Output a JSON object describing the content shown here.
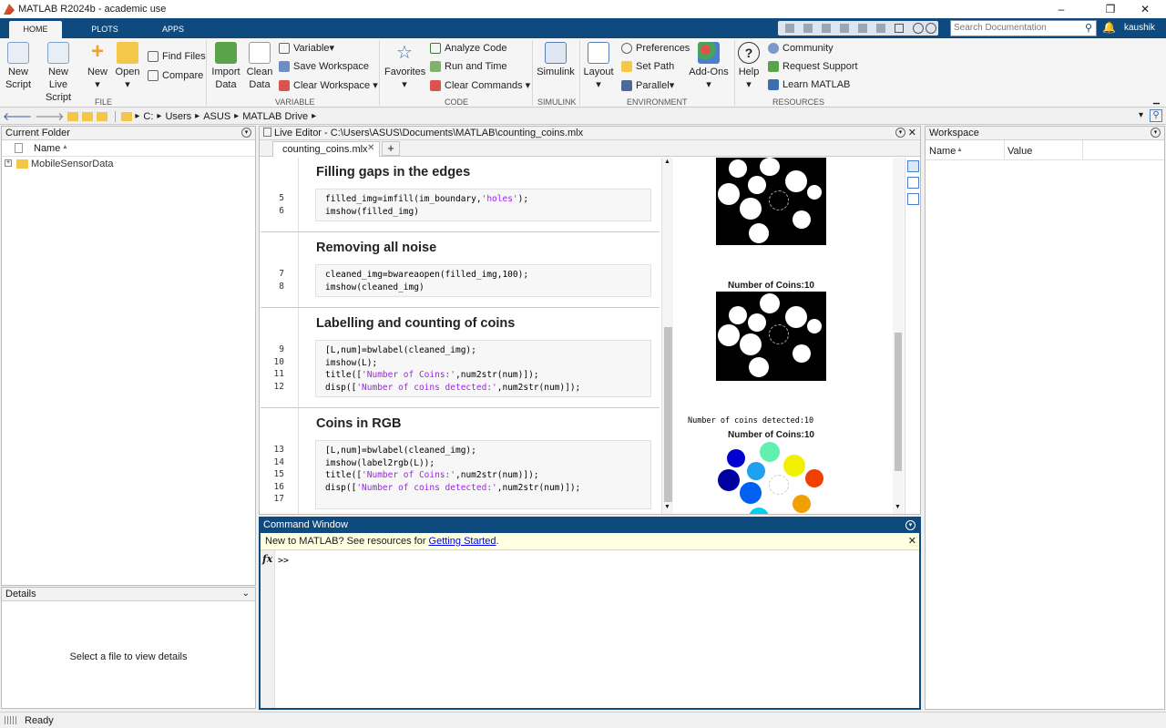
{
  "window": {
    "title": "MATLAB R2024b - academic use",
    "min": "–",
    "max": "❐",
    "close": "✕"
  },
  "ribbon_tabs": [
    "HOME",
    "PLOTS",
    "APPS"
  ],
  "search": {
    "placeholder": "Search Documentation"
  },
  "user": "kaushik",
  "ribbon": {
    "new_script": "New\nScript",
    "new_live_script": "New\nLive Script",
    "new": "New",
    "open": "Open",
    "find_files": "Find Files",
    "compare": "Compare",
    "import_data": "Import\nData",
    "clean_data": "Clean\nData",
    "variable": "Variable",
    "save_workspace": "Save Workspace",
    "clear_workspace": "Clear Workspace",
    "favorites": "Favorites",
    "analyze_code": "Analyze Code",
    "run_and_time": "Run and Time",
    "clear_commands": "Clear Commands",
    "simulink": "Simulink",
    "layout": "Layout",
    "preferences": "Preferences",
    "set_path": "Set Path",
    "parallel": "Parallel",
    "add_ons": "Add-Ons",
    "help": "Help",
    "community": "Community",
    "request_support": "Request Support",
    "learn_matlab": "Learn MATLAB",
    "groups": [
      "FILE",
      "VARIABLE",
      "CODE",
      "SIMULINK",
      "ENVIRONMENT",
      "RESOURCES"
    ]
  },
  "address": [
    "C:",
    "Users",
    "ASUS",
    "MATLAB Drive"
  ],
  "current_folder": {
    "title": "Current Folder",
    "column": "Name",
    "items": [
      "MobileSensorData"
    ]
  },
  "details": {
    "title": "Details",
    "empty": "Select a file to view details"
  },
  "editor": {
    "title": "Live Editor - C:\\Users\\ASUS\\Documents\\MATLAB\\counting_coins.mlx",
    "tab": "counting_coins.mlx",
    "sections": [
      {
        "heading": "Filling gaps in the edges",
        "lines": [
          "5",
          "6"
        ]
      },
      {
        "heading": "Removing all noise",
        "lines": [
          "7",
          "8"
        ]
      },
      {
        "heading": "Labelling and counting of coins",
        "lines": [
          "9",
          "10",
          "11",
          "12"
        ]
      },
      {
        "heading": "Coins in RGB",
        "lines": [
          "13",
          "14",
          "15",
          "16",
          "17"
        ]
      }
    ],
    "code": {
      "l5a": "filled_img=imfill(im_boundary,",
      "l5s": "'holes'",
      "l5b": ");",
      "l6": "imshow(filled_img)",
      "l7": "cleaned_img=bwareaopen(filled_img,100);",
      "l8": "imshow(cleaned_img)",
      "l9": "[L,num]=bwlabel(cleaned_img);",
      "l10": "imshow(L);",
      "l11a": "title([",
      "l11s": "'Number of Coins:'",
      "l11b": ",num2str(num)]);",
      "l12a": "disp([",
      "l12s": "'Number of coins detected:'",
      "l12b": ",num2str(num)]);",
      "l13": "[L,num]=bwlabel(cleaned_img);",
      "l14": "imshow(label2rgb(L));",
      "l15a": "title([",
      "l15s": "'Number of Coins:'",
      "l15b": ",num2str(num)]);",
      "l16a": "disp([",
      "l16s": "'Number of coins detected:'",
      "l16b": ",num2str(num)]);"
    },
    "output": {
      "fig_title": "Number of Coins:10",
      "fig_title2": "Number of Coins:10",
      "disp_text": "Number of coins detected:10"
    }
  },
  "command_window": {
    "title": "Command Window",
    "notice": "New to MATLAB? See resources for ",
    "link": "Getting Started",
    "period": ".",
    "fx": "fx",
    "prompt": ">>"
  },
  "workspace": {
    "title": "Workspace",
    "col_name": "Name",
    "col_value": "Value"
  },
  "status": {
    "text": "Ready"
  }
}
